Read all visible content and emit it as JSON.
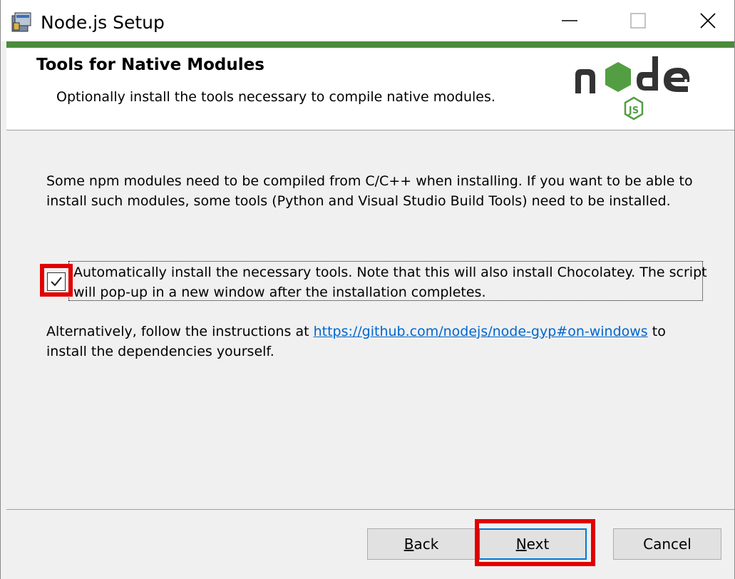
{
  "window": {
    "title": "Node.js Setup",
    "accent_color": "#4b8b3b"
  },
  "header": {
    "title": "Tools for Native Modules",
    "subtitle": "Optionally install the tools necessary to compile native modules.",
    "logo": "node-js-logo"
  },
  "body": {
    "description": "Some npm modules need to be compiled from C/C++ when installing. If you want to be able to install such modules, some tools (Python and Visual Studio Build Tools) need to be installed.",
    "checkbox": {
      "checked": true,
      "label": "Automatically install the necessary tools. Note that this will also install Chocolatey. The script will pop-up in a new window after the installation completes."
    },
    "alternative": {
      "prefix": "Alternatively, follow the instructions at ",
      "link_text": "https://github.com/nodejs/node-gyp#on-windows",
      "suffix": " to install the dependencies yourself."
    }
  },
  "footer": {
    "back": {
      "mnemonic": "B",
      "rest": "ack"
    },
    "next": {
      "mnemonic": "N",
      "rest": "ext"
    },
    "cancel": "Cancel"
  },
  "highlight_color": "#e00000"
}
